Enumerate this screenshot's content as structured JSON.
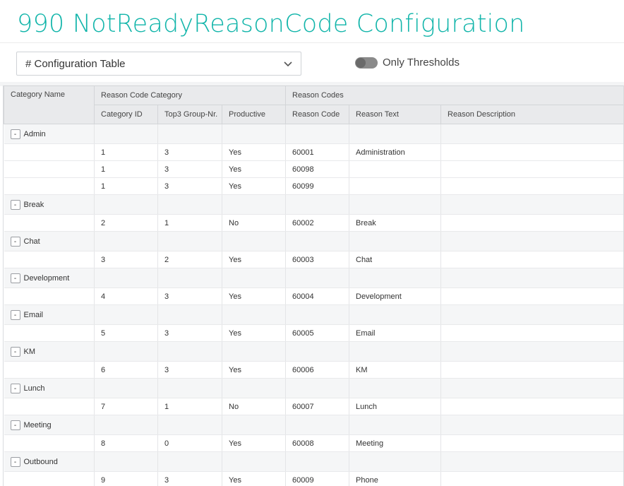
{
  "page": {
    "title": "990 NotReadyReasonCode Configuration"
  },
  "selector": {
    "value": "# Configuration Table",
    "icon": "chevron-down-icon"
  },
  "toggle": {
    "label": "Only Thresholds",
    "on": false
  },
  "table": {
    "header_groups": [
      "Category Name",
      "Reason Code Category",
      "Reason Codes"
    ],
    "columns": [
      "Category ID",
      "Top3 Group-Nr.",
      "Productive",
      "Reason Code",
      "Reason Text",
      "Reason Description"
    ],
    "groups": [
      {
        "name": "Admin",
        "toggle": "-",
        "rows": [
          [
            "1",
            "3",
            "Yes",
            "60001",
            "Administration",
            ""
          ],
          [
            "1",
            "3",
            "Yes",
            "60098",
            "",
            ""
          ],
          [
            "1",
            "3",
            "Yes",
            "60099",
            "",
            ""
          ]
        ]
      },
      {
        "name": "Break",
        "toggle": "-",
        "rows": [
          [
            "2",
            "1",
            "No",
            "60002",
            "Break",
            ""
          ]
        ]
      },
      {
        "name": "Chat",
        "toggle": "-",
        "rows": [
          [
            "3",
            "2",
            "Yes",
            "60003",
            "Chat",
            ""
          ]
        ]
      },
      {
        "name": "Development",
        "toggle": "-",
        "rows": [
          [
            "4",
            "3",
            "Yes",
            "60004",
            "Development",
            ""
          ]
        ]
      },
      {
        "name": "Email",
        "toggle": "-",
        "rows": [
          [
            "5",
            "3",
            "Yes",
            "60005",
            "Email",
            ""
          ]
        ]
      },
      {
        "name": "KM",
        "toggle": "-",
        "rows": [
          [
            "6",
            "3",
            "Yes",
            "60006",
            "KM",
            ""
          ]
        ]
      },
      {
        "name": "Lunch",
        "toggle": "-",
        "rows": [
          [
            "7",
            "1",
            "No",
            "60007",
            "Lunch",
            ""
          ]
        ]
      },
      {
        "name": "Meeting",
        "toggle": "-",
        "rows": [
          [
            "8",
            "0",
            "Yes",
            "60008",
            "Meeting",
            ""
          ]
        ]
      },
      {
        "name": "Outbound",
        "toggle": "-",
        "rows": [
          [
            "9",
            "3",
            "Yes",
            "60009",
            "Phone",
            ""
          ]
        ]
      }
    ]
  },
  "colors": {
    "title": "#12b5aa",
    "header_bg": "#e9eaec",
    "group_bg": "#f5f6f7"
  }
}
